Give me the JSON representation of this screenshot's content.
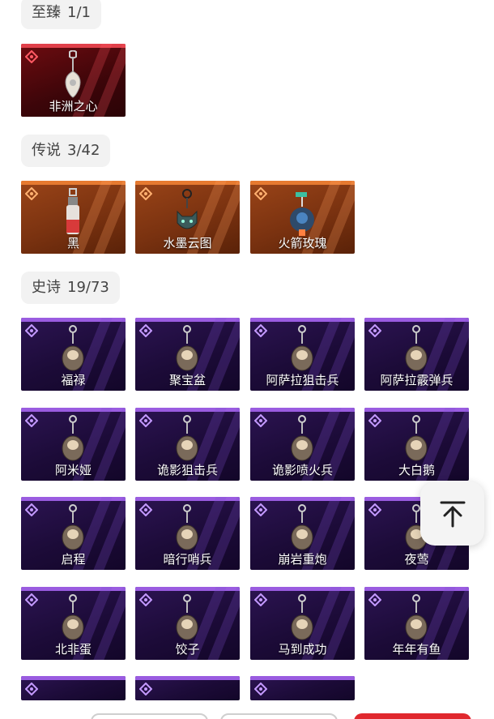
{
  "sections": {
    "rare": {
      "label": "至臻",
      "count": "1/1"
    },
    "legend": {
      "label": "传说",
      "count": "3/42"
    },
    "epic": {
      "label": "史诗",
      "count": "19/73"
    }
  },
  "items": {
    "rare": [
      {
        "name": "非洲之心"
      }
    ],
    "legend": [
      {
        "name": "黑"
      },
      {
        "name": "水墨云图"
      },
      {
        "name": "火箭玫瑰"
      }
    ],
    "epic": [
      {
        "name": "福禄"
      },
      {
        "name": "聚宝盆"
      },
      {
        "name": "阿萨拉狙击兵"
      },
      {
        "name": "阿萨拉霰弹兵"
      },
      {
        "name": "阿米娅"
      },
      {
        "name": "诡影狙击兵"
      },
      {
        "name": "诡影喷火兵"
      },
      {
        "name": "大白鹅"
      },
      {
        "name": "启程"
      },
      {
        "name": "暗行哨兵"
      },
      {
        "name": "崩岩重炮"
      },
      {
        "name": "夜莺"
      },
      {
        "name": "北非蛋"
      },
      {
        "name": "饺子"
      },
      {
        "name": "马到成功"
      },
      {
        "name": "年年有鱼"
      }
    ]
  },
  "colors": {
    "rare_accent": "#e0404a",
    "legend_accent": "#e67a30",
    "epic_accent": "#9a5ce0",
    "primary_button": "#e0282e"
  },
  "icons": {
    "scroll_top": "arrow-up-to-top-icon"
  }
}
